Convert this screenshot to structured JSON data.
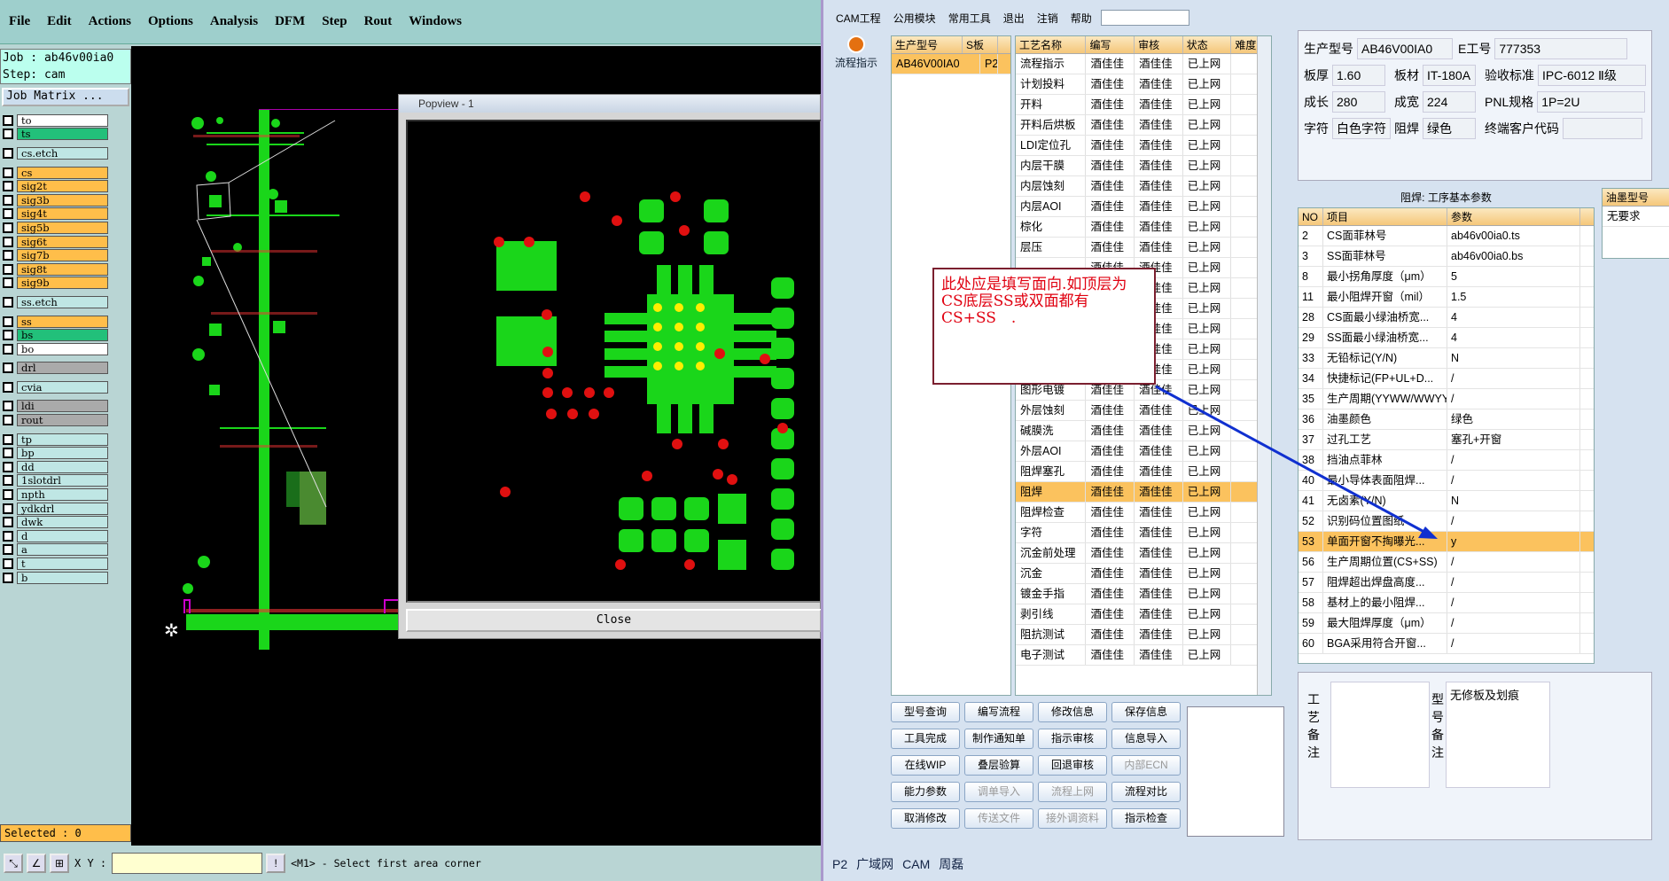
{
  "cam": {
    "menu": [
      "File",
      "Edit",
      "Actions",
      "Options",
      "Analysis",
      "DFM",
      "Step",
      "Rout",
      "Windows"
    ],
    "job_line": "Job : ab46v00ia0",
    "step_line": "Step: cam",
    "job_matrix": "Job Matrix ...",
    "layers": [
      {
        "name": "to",
        "color": "#ffffff"
      },
      {
        "name": "ts",
        "color": "#22c07a"
      },
      {
        "name": "cs.etch",
        "color": "#bfe6e4"
      },
      {
        "name": "cs",
        "color": "#ffbe4a"
      },
      {
        "name": "sig2t",
        "color": "#ffbe4a"
      },
      {
        "name": "sig3b",
        "color": "#ffbe4a"
      },
      {
        "name": "sig4t",
        "color": "#ffbe4a"
      },
      {
        "name": "sig5b",
        "color": "#ffbe4a"
      },
      {
        "name": "sig6t",
        "color": "#ffbe4a"
      },
      {
        "name": "sig7b",
        "color": "#ffbe4a"
      },
      {
        "name": "sig8t",
        "color": "#ffbe4a"
      },
      {
        "name": "sig9b",
        "color": "#ffbe4a"
      },
      {
        "name": "ss.etch",
        "color": "#bfe6e4"
      },
      {
        "name": "ss",
        "color": "#ffbe4a"
      },
      {
        "name": "bs",
        "color": "#22c07a"
      },
      {
        "name": "bo",
        "color": "#ffffff"
      },
      {
        "name": "drl",
        "color": "#aaaaaa"
      },
      {
        "name": "cvia",
        "color": "#bfe6e4"
      },
      {
        "name": "ldi",
        "color": "#aaaaaa"
      },
      {
        "name": "rout",
        "color": "#aaaaaa"
      },
      {
        "name": "tp",
        "color": "#bfe6e4"
      },
      {
        "name": "bp",
        "color": "#bfe6e4"
      },
      {
        "name": "dd",
        "color": "#bfe6e4"
      },
      {
        "name": "1slotdrl",
        "color": "#bfe6e4"
      },
      {
        "name": "npth",
        "color": "#bfe6e4"
      },
      {
        "name": "ydkdrl",
        "color": "#bfe6e4"
      },
      {
        "name": "dwk",
        "color": "#bfe6e4"
      },
      {
        "name": "d",
        "color": "#bfe6e4"
      },
      {
        "name": "a",
        "color": "#bfe6e4"
      },
      {
        "name": "t",
        "color": "#bfe6e4"
      },
      {
        "name": "b",
        "color": "#bfe6e4"
      }
    ],
    "selected": "Selected : 0",
    "xy_label": "X Y :",
    "status": "<M1> - Select first area corner",
    "popview_title": "Popview - 1",
    "close_label": "Close"
  },
  "erp": {
    "menu": [
      "CAM工程",
      "公用模块",
      "常用工具",
      "退出",
      "注销",
      "帮助"
    ],
    "flow_button": "流程指示",
    "grid1_headers": [
      "生产型号",
      "S板"
    ],
    "grid1_row": "AB46V00IA0",
    "grid1_row2": "P2",
    "grid2_headers": [
      "工艺名称",
      "编写",
      "审核",
      "状态",
      "难度"
    ],
    "processes": [
      "流程指示",
      "计划投料",
      "开料",
      "开料后烘板",
      "LDI定位孔",
      "内层干膜",
      "内层蚀刻",
      "内层AOI",
      "棕化",
      "层压",
      "",
      "",
      "",
      "",
      "",
      "干膜检查",
      "图形电镀",
      "外层蚀刻",
      "碱膜洗",
      "外层AOI",
      "阻焊塞孔",
      "阻焊",
      "阻焊检查",
      "字符",
      "沉金前处理",
      "沉金",
      "镀金手指",
      "剥引线",
      "阻抗测试",
      "电子测试"
    ],
    "writer": "酒佳佳",
    "reviewer": "酒佳佳",
    "state": "已上网",
    "selected_process_index": 21,
    "buttons": [
      "型号查询",
      "编写流程",
      "修改信息",
      "保存信息",
      "工具完成",
      "制作通知单",
      "指示审核",
      "信息导入",
      "在线WIP",
      "叠层验算",
      "回退审核",
      "内部ECN",
      "能力参数",
      "调单导入",
      "流程上网",
      "流程对比",
      "取消修改",
      "传送文件",
      "接外调资料",
      "指示检查"
    ],
    "disabled_buttons": [
      11,
      13,
      14,
      17,
      18
    ],
    "info": {
      "model_label": "生产型号",
      "model": "AB46V00IA0",
      "eno_label": "E工号",
      "eno": "777353",
      "thick_label": "板厚",
      "thick": "1.60",
      "mat_label": "板材",
      "mat": "IT-180A",
      "std_label": "验收标准",
      "std": "IPC-6012 Ⅱ级",
      "len_label": "成长",
      "len": "280",
      "wid_label": "成宽",
      "wid": "224",
      "pnl_label": "PNL规格",
      "pnl": "1P=2U",
      "char_label": "字符",
      "char": "白色字符",
      "mask_label": "阻焊",
      "mask": "绿色",
      "cust_label": "终端客户代码"
    },
    "param_title": "阻焊: 工序基本参数",
    "param_headers": [
      "NO",
      "项目",
      "参数"
    ],
    "params": [
      [
        "2",
        "CS面菲林号",
        "ab46v00ia0.ts"
      ],
      [
        "3",
        "SS面菲林号",
        "ab46v00ia0.bs"
      ],
      [
        "8",
        "最小拐角厚度（μm）",
        "5"
      ],
      [
        "11",
        "最小阻焊开窗（mil）",
        "1.5"
      ],
      [
        "28",
        "CS面最小绿油桥宽...",
        "4"
      ],
      [
        "29",
        "SS面最小绿油桥宽...",
        "4"
      ],
      [
        "33",
        "无铅标记(Y/N)",
        "N"
      ],
      [
        "34",
        "快捷标记(FP+UL+D...",
        "/"
      ],
      [
        "35",
        "生产周期(YYWW/WWYY)",
        "/"
      ],
      [
        "36",
        "油墨颜色",
        "绿色"
      ],
      [
        "37",
        "过孔工艺",
        "塞孔+开窗"
      ],
      [
        "38",
        "挡油点菲林",
        "/"
      ],
      [
        "40",
        "最小导体表面阻焊...",
        "/"
      ],
      [
        "41",
        "无卤素(Y/N)",
        "N"
      ],
      [
        "52",
        "识别码位置图纸",
        "/"
      ],
      [
        "53",
        "单面开窗不掏曝光...",
        "y"
      ],
      [
        "56",
        "生产周期位置(CS+SS)",
        "/"
      ],
      [
        "57",
        "阻焊超出焊盘高度...",
        "/"
      ],
      [
        "58",
        "基材上的最小阻焊...",
        "/"
      ],
      [
        "59",
        "最大阻焊厚度（μm）",
        "/"
      ],
      [
        "60",
        "BGA采用符合开窗...",
        "/"
      ]
    ],
    "selected_param_index": 15,
    "ink_header": "油墨型号",
    "ink_value": "无要求",
    "notes_label": "工艺备注",
    "model_notes_label": "型号备注",
    "model_notes": "无修板及划痕",
    "status_tabs": [
      "P2",
      "广域网",
      "CAM",
      "周磊"
    ],
    "callout": "此处应是填写面向.如顶层为CS底层SS或双面都有CS+SS　."
  }
}
